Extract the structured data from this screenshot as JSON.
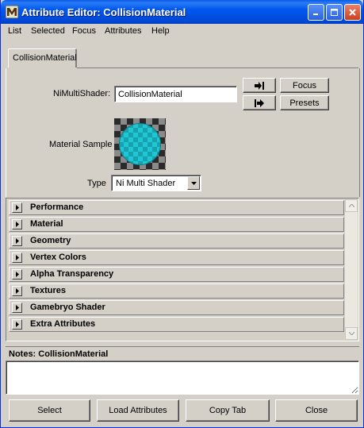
{
  "window": {
    "title": "Attribute Editor: CollisionMaterial",
    "title_icon": "maya-m-icon",
    "controls": [
      "minimize-icon",
      "maximize-icon",
      "close-icon"
    ]
  },
  "menu": {
    "items": [
      "List",
      "Selected",
      "Focus",
      "Attributes",
      "Help"
    ]
  },
  "tabs": [
    {
      "label": "CollisionMaterial",
      "active": true
    }
  ],
  "node": {
    "type_label": "NiMultiShader:",
    "name_value": "CollisionMaterial",
    "load_icon": "input-connection-icon",
    "output_icon": "output-connection-icon",
    "focus_label": "Focus",
    "presets_label": "Presets"
  },
  "material_sample": {
    "label": "Material Sample",
    "sphere_color": "#1ec8d8",
    "check_dark": "#2a2a2a",
    "check_light": "#8a8a8a"
  },
  "type_select": {
    "label": "Type",
    "value": "Ni Multi Shader"
  },
  "frames": [
    {
      "label": "Performance"
    },
    {
      "label": "Material"
    },
    {
      "label": "Geometry"
    },
    {
      "label": "Vertex Colors"
    },
    {
      "label": "Alpha Transparency"
    },
    {
      "label": "Textures"
    },
    {
      "label": "Gamebryo Shader"
    },
    {
      "label": "Extra Attributes"
    }
  ],
  "notes": {
    "header": "Notes: CollisionMaterial",
    "value": ""
  },
  "buttons": {
    "select": "Select",
    "load_attributes": "Load Attributes",
    "copy_tab": "Copy Tab",
    "close": "Close"
  },
  "colors": {
    "titlebar": "#0058ee",
    "face": "#d4d0c8"
  }
}
